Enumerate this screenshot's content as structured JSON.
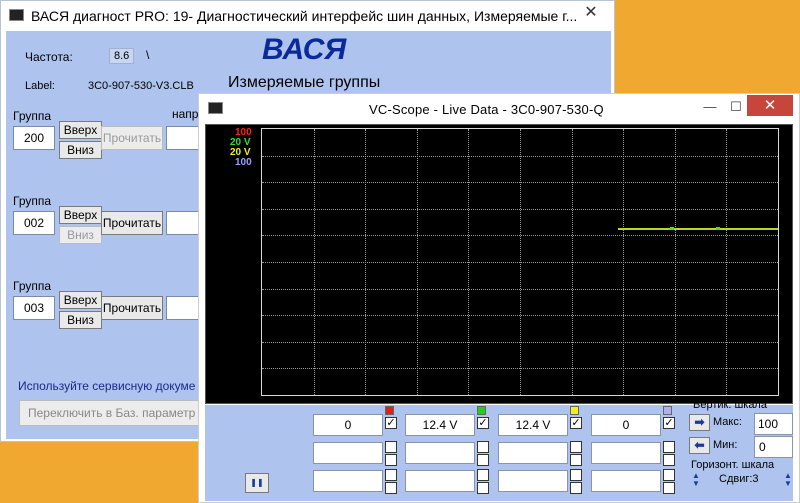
{
  "back_window": {
    "title": "ВАСЯ диагност PRO: 19- Диагностический интерфейс шин данных,  Измеряемые г...",
    "close_glyph": "✕",
    "freq_label": "Частота:",
    "freq_value": "8.6",
    "freq_suffix": "\\",
    "brand": "ВАСЯ",
    "label_caption": "Label:",
    "label_value": "3C0-907-530-V3.CLB",
    "section_title": "Измеряемые группы",
    "partial_label": "напр",
    "groups": [
      {
        "caption": "Группа",
        "number": "200",
        "up": "Вверх",
        "down": "Вниз",
        "read": "Прочитать"
      },
      {
        "caption": "Группа",
        "number": "002",
        "up": "Вверх",
        "down": "Вниз",
        "read": "Прочитать"
      },
      {
        "caption": "Группа",
        "number": "003",
        "up": "Вверх",
        "down": "Вниз",
        "read": "Прочитать"
      }
    ],
    "hint_text": "Используйте сервисную докуме",
    "switch_button": "Переключить в Баз. параметр"
  },
  "scope_window": {
    "title": "VC-Scope  -  Live Data  -  3C0-907-530-Q",
    "controls": {
      "minimize": "—",
      "maximize": "☐",
      "close": "✕"
    },
    "channel_labels": [
      {
        "text": "100",
        "color": "#ff2020"
      },
      {
        "text": "20 V",
        "color": "#30e030"
      },
      {
        "text": "20 V",
        "color": "#f0f020"
      },
      {
        "text": "100",
        "color": "#9aa0ff"
      }
    ],
    "trace_color": "#b8d820",
    "channels": [
      {
        "value": "0",
        "color": "#e02020",
        "checked": true
      },
      {
        "value": "12.4 V",
        "color": "#20d020",
        "checked": true
      },
      {
        "value": "12.4 V",
        "color": "#f0f020",
        "checked": true
      },
      {
        "value": "0",
        "color": "#b0b0f0",
        "checked": true
      }
    ],
    "check_glyph": "✓",
    "vert_scale_label": "Вертик. шкала",
    "max_label": "Макс:",
    "max_value": "100",
    "min_label": "Мин:",
    "min_value": "0",
    "horiz_scale_label": "Горизонт. шкала",
    "shift_label": "Сдвиг:3",
    "pause_glyph": "❚❚"
  }
}
